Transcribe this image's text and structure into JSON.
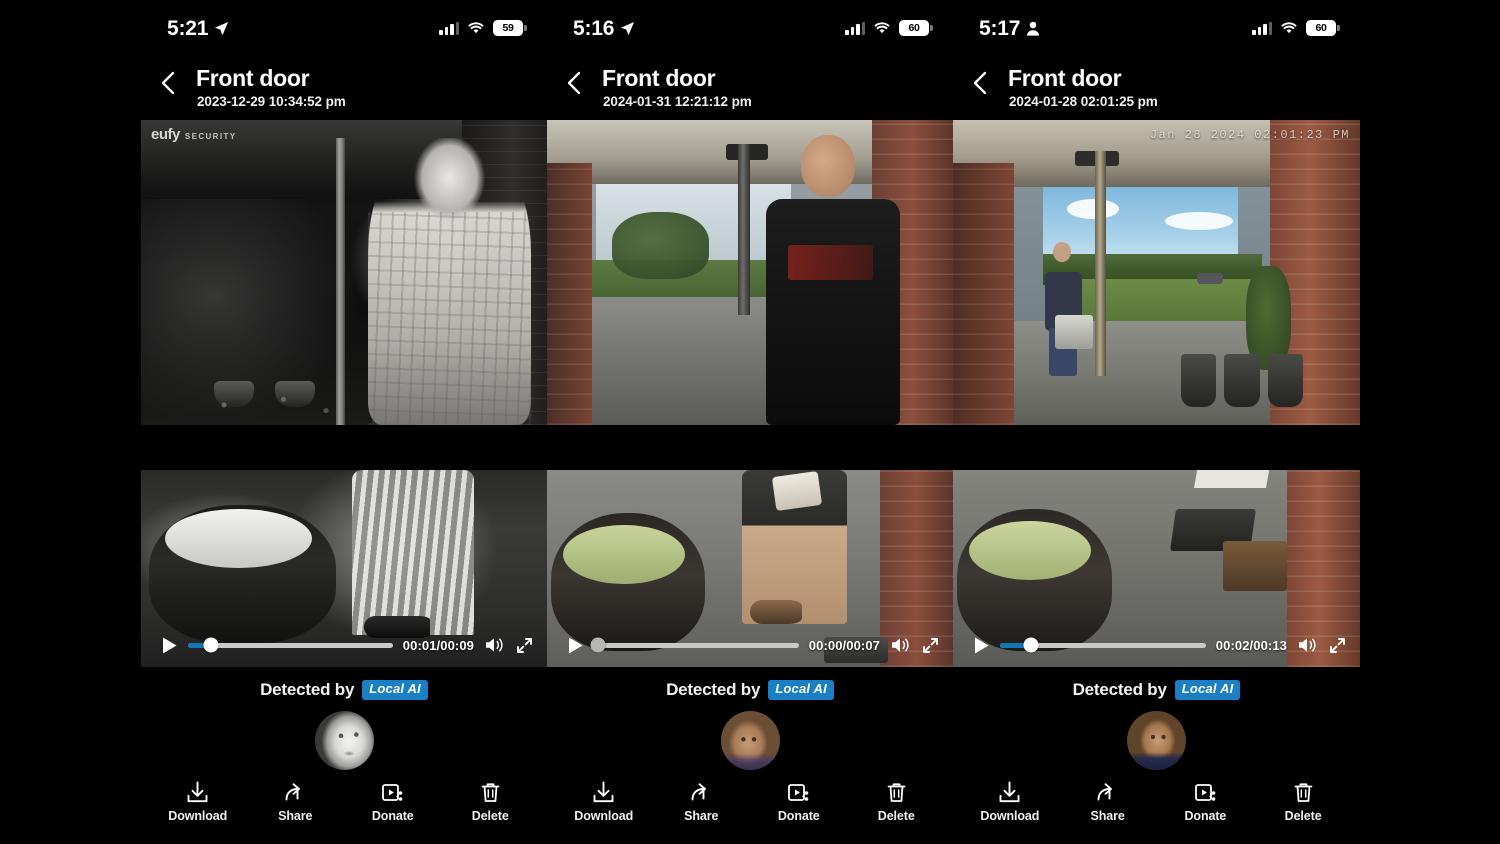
{
  "app": {
    "name": "eufy Security",
    "watermark": {
      "brand": "eufy",
      "sub": "SECURITY"
    }
  },
  "panels": [
    {
      "status_bar": {
        "time": "5:21",
        "status_glyph": "location-arrow-icon",
        "signal_icon": "cellular-signal-icon",
        "wifi_icon": "wifi-icon",
        "battery_percent": "59"
      },
      "header": {
        "back_icon": "back-chevron-icon",
        "title": "Front door",
        "timestamp": "2023-12-29 10:34:52 pm"
      },
      "video": {
        "has_watermark": true,
        "overlay_timestamp": "",
        "scene": "night-bw-porch-man-plaid-shirt"
      },
      "player": {
        "play_icon": "play-icon",
        "progress_percent": 11,
        "time_display": "00:01/00:09",
        "volume_icon": "volume-on-icon",
        "fullscreen_icon": "fullscreen-icon"
      },
      "detection": {
        "label": "Detected by",
        "badge": "Local AI",
        "face_icon": "face-thumbnail"
      },
      "actions": [
        {
          "label": "Download",
          "icon": "download-icon"
        },
        {
          "label": "Share",
          "icon": "share-icon"
        },
        {
          "label": "Donate",
          "icon": "donate-video-icon"
        },
        {
          "label": "Delete",
          "icon": "trash-icon"
        }
      ]
    },
    {
      "status_bar": {
        "time": "5:16",
        "status_glyph": "location-arrow-icon",
        "signal_icon": "cellular-signal-icon",
        "wifi_icon": "wifi-icon",
        "battery_percent": "60"
      },
      "header": {
        "back_icon": "back-chevron-icon",
        "title": "Front door",
        "timestamp": "2024-01-31 12:21:12 pm"
      },
      "video": {
        "has_watermark": false,
        "overlay_timestamp": "",
        "scene": "daytime-porch-man-black-shirt"
      },
      "player": {
        "play_icon": "play-icon",
        "progress_percent": 2,
        "time_display": "00:00/00:07",
        "volume_icon": "volume-on-icon",
        "fullscreen_icon": "fullscreen-icon"
      },
      "detection": {
        "label": "Detected by",
        "badge": "Local AI",
        "face_icon": "face-thumbnail"
      },
      "actions": [
        {
          "label": "Download",
          "icon": "download-icon"
        },
        {
          "label": "Share",
          "icon": "share-icon"
        },
        {
          "label": "Donate",
          "icon": "donate-video-icon"
        },
        {
          "label": "Delete",
          "icon": "trash-icon"
        }
      ]
    },
    {
      "status_bar": {
        "time": "5:17",
        "status_glyph": "person-icon",
        "signal_icon": "cellular-signal-icon",
        "wifi_icon": "wifi-icon",
        "battery_percent": "60"
      },
      "header": {
        "back_icon": "back-chevron-icon",
        "title": "Front door",
        "timestamp": "2024-01-28 02:01:25 pm"
      },
      "video": {
        "has_watermark": false,
        "overlay_timestamp": "Jan 28 2024  02:01:23 PM",
        "scene": "bright-daylight-porch-man-carrying-box"
      },
      "player": {
        "play_icon": "play-icon",
        "progress_percent": 15,
        "time_display": "00:02/00:13",
        "volume_icon": "volume-on-icon",
        "fullscreen_icon": "fullscreen-icon"
      },
      "detection": {
        "label": "Detected by",
        "badge": "Local AI",
        "face_icon": "face-thumbnail"
      },
      "actions": [
        {
          "label": "Download",
          "icon": "download-icon"
        },
        {
          "label": "Share",
          "icon": "share-icon"
        },
        {
          "label": "Donate",
          "icon": "donate-video-icon"
        },
        {
          "label": "Delete",
          "icon": "trash-icon"
        }
      ]
    }
  ],
  "colors": {
    "background": "#000000",
    "accent_blue": "#1178b3",
    "badge_blue": "#1a7fc4",
    "text_primary": "#ffffff",
    "seek_track": "#c9c9c9"
  }
}
